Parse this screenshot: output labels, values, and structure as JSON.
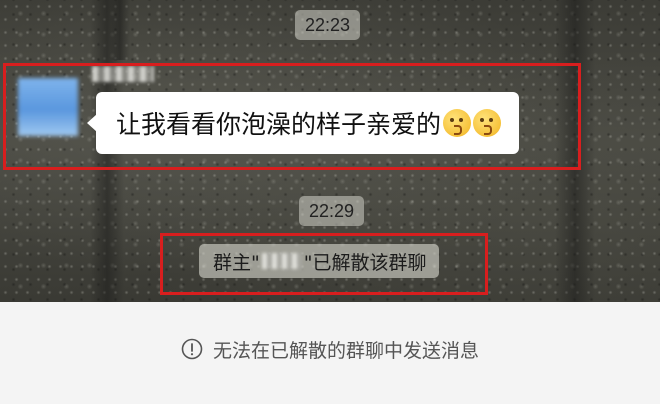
{
  "chat": {
    "timestamps": [
      "22:23",
      "22:29"
    ],
    "message": {
      "sender_name": "",
      "text": "让我看看你泡澡的样子亲爱的",
      "emojis": [
        "kissing-face-icon",
        "kissing-face-icon"
      ]
    },
    "system_message": {
      "prefix": "群主\"",
      "redacted_name": "",
      "suffix": "\"已解散该群聊"
    }
  },
  "footer": {
    "icon": "alert-circle-icon",
    "notice": "无法在已解散的群聊中发送消息"
  },
  "highlight_color": "#d81e1e"
}
